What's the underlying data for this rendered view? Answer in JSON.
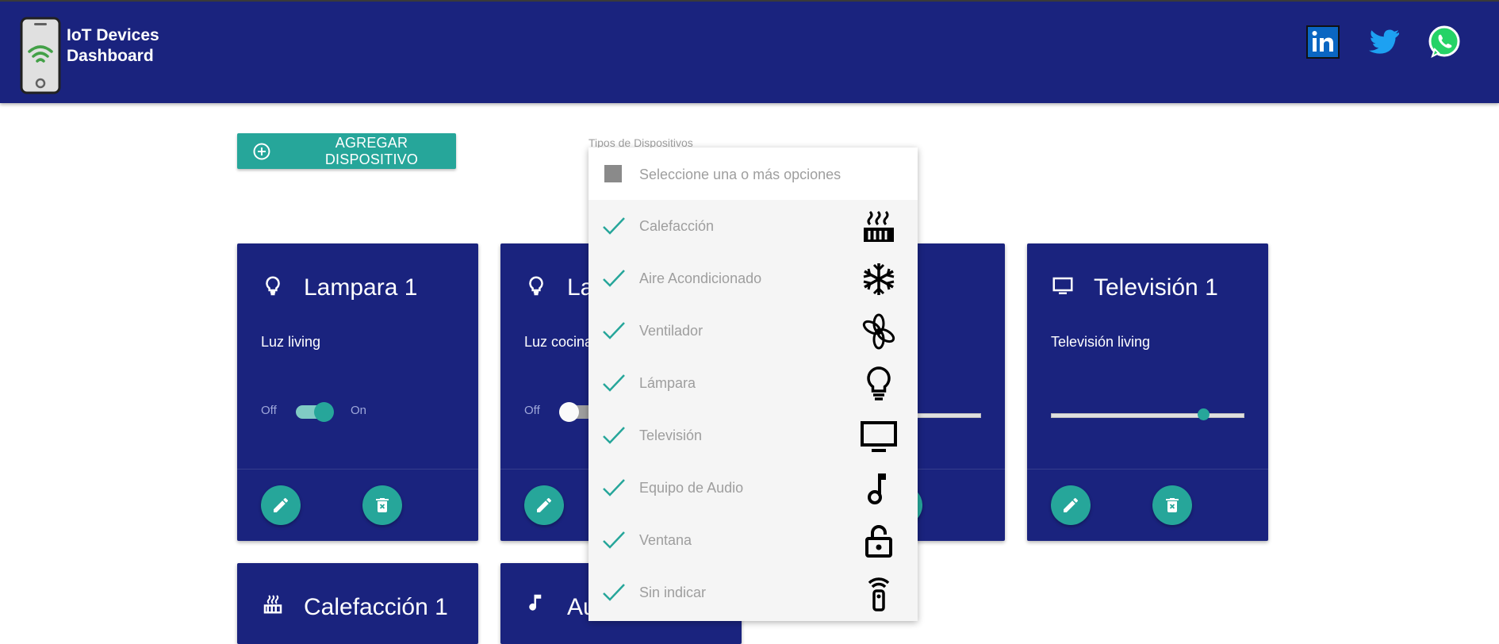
{
  "header": {
    "brand_line1": "IoT Devices",
    "brand_line2": "Dashboard",
    "social": [
      "linkedin-icon",
      "twitter-icon",
      "whatsapp-icon"
    ]
  },
  "toolbar": {
    "add_label": "AGREGAR DISPOSITIVO"
  },
  "filter": {
    "label": "Tipos de Dispositivos",
    "placeholder": "Seleccione una o más opciones",
    "options": [
      {
        "label": "Calefacción",
        "icon": "heater-icon",
        "checked": true
      },
      {
        "label": "Aire Acondicionado",
        "icon": "snowflake-icon",
        "checked": true
      },
      {
        "label": "Ventilador",
        "icon": "fan-icon",
        "checked": true
      },
      {
        "label": "Lámpara",
        "icon": "lightbulb-icon",
        "checked": true
      },
      {
        "label": "Televisión",
        "icon": "tv-icon",
        "checked": true
      },
      {
        "label": "Equipo de Audio",
        "icon": "music-note-icon",
        "checked": true
      },
      {
        "label": "Ventana",
        "icon": "lock-open-icon",
        "checked": true
      },
      {
        "label": "Sin indicar",
        "icon": "remote-icon",
        "checked": true
      }
    ]
  },
  "cards": [
    {
      "title": "Lampara 1",
      "desc": "Luz living",
      "icon": "lightbulb-icon",
      "control": "switch",
      "state": "on",
      "off_label": "Off",
      "on_label": "On"
    },
    {
      "title": "La",
      "desc": "Luz cocina",
      "icon": "lightbulb-icon",
      "control": "switch",
      "state": "off",
      "off_label": "Off"
    },
    {
      "title": "",
      "desc": "",
      "icon": "",
      "control": "slider"
    },
    {
      "title": "Televisión 1",
      "desc": "Televisión living",
      "icon": "tv-icon",
      "control": "slider",
      "level": 0.78
    },
    {
      "title": "Calefacción 1",
      "icon": "heater-icon"
    },
    {
      "title": "Au",
      "icon": "music-note-icon"
    }
  ],
  "colors": {
    "primary": "#1a237e",
    "accent": "#26a69a"
  }
}
